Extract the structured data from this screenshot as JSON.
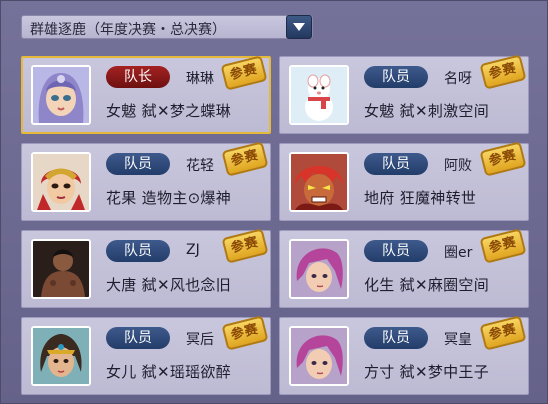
{
  "header": {
    "dropdown_label": "群雄逐鹿（年度决赛・总决赛）"
  },
  "stamp_label": "参赛",
  "colors": {
    "leader_badge": "#8b1a1a",
    "member_badge": "#2d4a7a",
    "selected_border": "#e7b93a"
  },
  "members": [
    {
      "role": "队长",
      "name": "琳琳",
      "detail": "女魃 弑✕梦之蝶琳",
      "avatar": "fairy-girl-avatar",
      "selected": true
    },
    {
      "role": "队员",
      "name": "名呀",
      "detail": "女魃 弑✕刺激空间",
      "avatar": "snowman-avatar",
      "selected": false
    },
    {
      "role": "队员",
      "name": "花轻",
      "detail": "花果 造物主⊙爆神",
      "avatar": "monkey-king-avatar",
      "selected": false
    },
    {
      "role": "队员",
      "name": "阿败",
      "detail": "地府 狂魔神转世",
      "avatar": "demon-avatar",
      "selected": false
    },
    {
      "role": "队员",
      "name": "ZJ",
      "detail": "大唐 弑✕风也念旧",
      "avatar": "photo-man-avatar",
      "selected": false
    },
    {
      "role": "队员",
      "name": "圈er",
      "detail": "化生 弑✕麻圈空间",
      "avatar": "pink-hair-avatar",
      "selected": false
    },
    {
      "role": "队员",
      "name": "冥后",
      "detail": "女儿 弑✕瑶瑶欲醉",
      "avatar": "dancer-girl-avatar",
      "selected": false
    },
    {
      "role": "队员",
      "name": "冥皇",
      "detail": "方寸 弑✕梦中王子",
      "avatar": "pink-hair-avatar",
      "selected": false
    }
  ]
}
